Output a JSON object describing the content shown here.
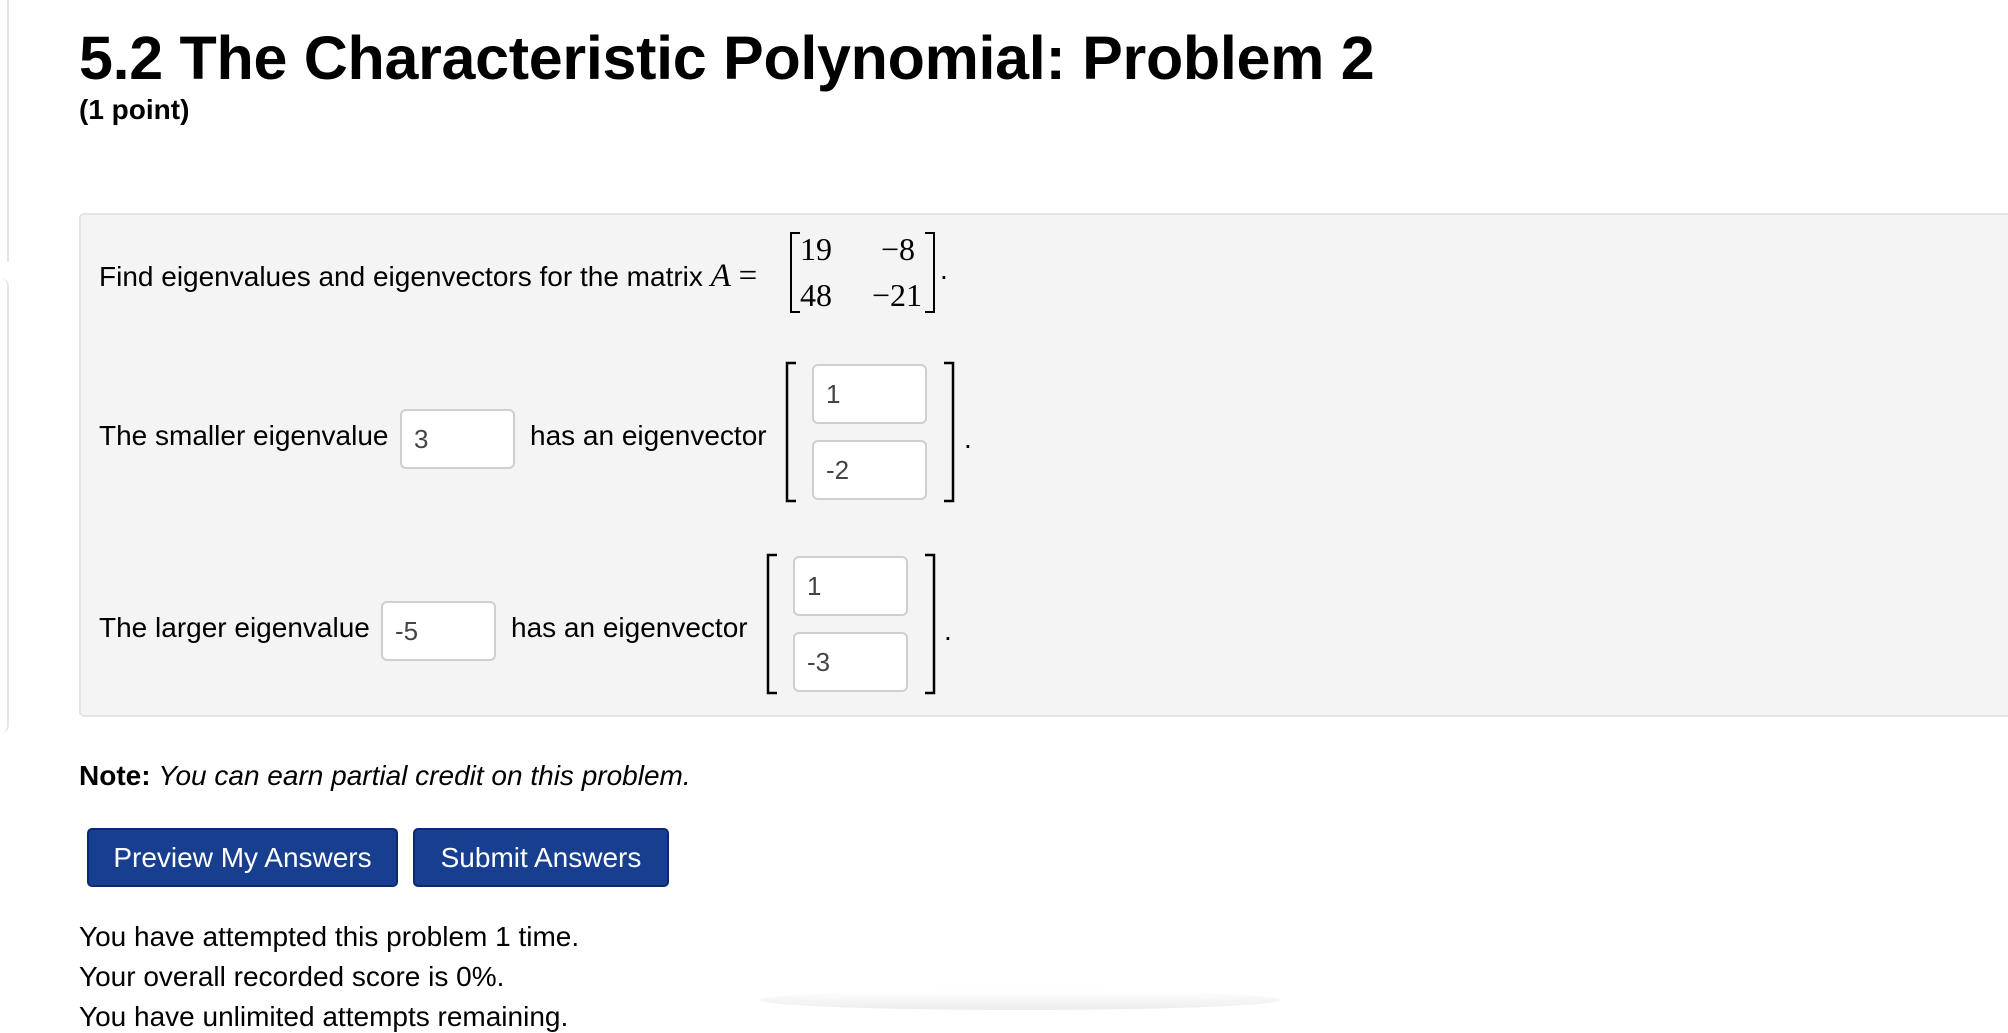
{
  "page": {
    "title": "5.2 The Characteristic Polynomial: Problem 2",
    "points": "(1 point)"
  },
  "problem": {
    "intro": "Find eigenvalues and eigenvectors for the matrix",
    "matrix_var": "A",
    "equals": "=",
    "matrix": [
      [
        "19",
        "−8"
      ],
      [
        "48",
        "−21"
      ]
    ],
    "period": ".",
    "smaller": {
      "label": "The smaller eigenvalue",
      "value": "3",
      "eigvec_text": "has an eigenvector",
      "vector": [
        "1",
        "-2"
      ]
    },
    "larger": {
      "label": "The larger eigenvalue",
      "value": "-5",
      "eigvec_text": "has an eigenvector",
      "vector": [
        "1",
        "-3"
      ]
    }
  },
  "note": {
    "label": "Note:",
    "text": "You can earn partial credit on this problem."
  },
  "buttons": {
    "preview": "Preview My Answers",
    "submit": "Submit Answers"
  },
  "status": {
    "attempts": "You have attempted this problem 1 time.",
    "score": "Your overall recorded score is 0%.",
    "unlimited": "You have unlimited attempts remaining."
  }
}
